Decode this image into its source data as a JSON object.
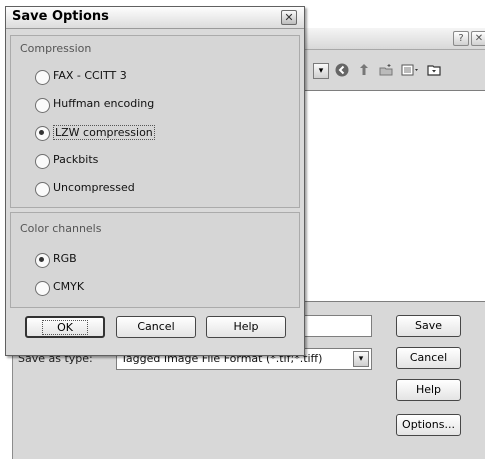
{
  "background_dialog": {
    "title_help_glyph": "?",
    "title_close_glyph": "✕",
    "toolbar_icons": [
      "dropdown-arrow",
      "back-icon",
      "up-folder-icon",
      "new-folder-icon",
      "views-icon",
      "folder-icon"
    ],
    "file_name_value": "",
    "save_as_type_label": "Save as type:",
    "save_as_type_value": "Tagged Image File Format (*.tif;*.tiff)",
    "buttons": {
      "save": "Save",
      "cancel": "Cancel",
      "help": "Help",
      "options": "Options..."
    }
  },
  "save_options": {
    "title": "Save Options",
    "close_glyph": "✕",
    "compression": {
      "title": "Compression",
      "options": [
        {
          "label": "FAX - CCITT 3",
          "selected": false
        },
        {
          "label": "Huffman encoding",
          "selected": false
        },
        {
          "label": "LZW compression",
          "selected": true
        },
        {
          "label": "Packbits",
          "selected": false
        },
        {
          "label": "Uncompressed",
          "selected": false
        }
      ]
    },
    "color_channels": {
      "title": "Color channels",
      "options": [
        {
          "label": "RGB",
          "selected": true
        },
        {
          "label": "CMYK",
          "selected": false
        }
      ]
    },
    "buttons": {
      "ok": "OK",
      "cancel": "Cancel",
      "help": "Help"
    }
  },
  "colors": {
    "dialog_bg": "#dadada",
    "window_bg": "#d8d8d8",
    "field_bg": "#ffffff"
  }
}
